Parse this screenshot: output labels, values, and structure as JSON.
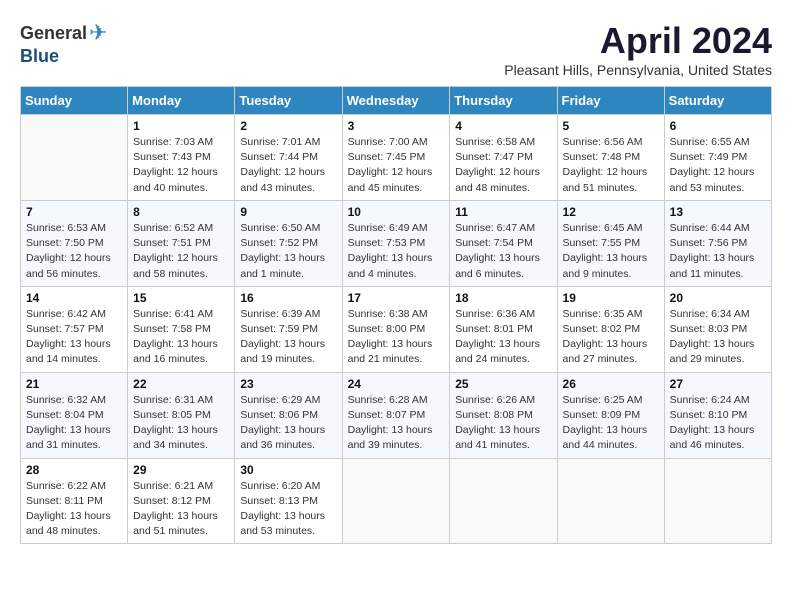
{
  "header": {
    "logo_general": "General",
    "logo_blue": "Blue",
    "title": "April 2024",
    "subtitle": "Pleasant Hills, Pennsylvania, United States"
  },
  "days_of_week": [
    "Sunday",
    "Monday",
    "Tuesday",
    "Wednesday",
    "Thursday",
    "Friday",
    "Saturday"
  ],
  "weeks": [
    [
      {
        "day": "",
        "info": ""
      },
      {
        "day": "1",
        "info": "Sunrise: 7:03 AM\nSunset: 7:43 PM\nDaylight: 12 hours\nand 40 minutes."
      },
      {
        "day": "2",
        "info": "Sunrise: 7:01 AM\nSunset: 7:44 PM\nDaylight: 12 hours\nand 43 minutes."
      },
      {
        "day": "3",
        "info": "Sunrise: 7:00 AM\nSunset: 7:45 PM\nDaylight: 12 hours\nand 45 minutes."
      },
      {
        "day": "4",
        "info": "Sunrise: 6:58 AM\nSunset: 7:47 PM\nDaylight: 12 hours\nand 48 minutes."
      },
      {
        "day": "5",
        "info": "Sunrise: 6:56 AM\nSunset: 7:48 PM\nDaylight: 12 hours\nand 51 minutes."
      },
      {
        "day": "6",
        "info": "Sunrise: 6:55 AM\nSunset: 7:49 PM\nDaylight: 12 hours\nand 53 minutes."
      }
    ],
    [
      {
        "day": "7",
        "info": "Sunrise: 6:53 AM\nSunset: 7:50 PM\nDaylight: 12 hours\nand 56 minutes."
      },
      {
        "day": "8",
        "info": "Sunrise: 6:52 AM\nSunset: 7:51 PM\nDaylight: 12 hours\nand 58 minutes."
      },
      {
        "day": "9",
        "info": "Sunrise: 6:50 AM\nSunset: 7:52 PM\nDaylight: 13 hours\nand 1 minute."
      },
      {
        "day": "10",
        "info": "Sunrise: 6:49 AM\nSunset: 7:53 PM\nDaylight: 13 hours\nand 4 minutes."
      },
      {
        "day": "11",
        "info": "Sunrise: 6:47 AM\nSunset: 7:54 PM\nDaylight: 13 hours\nand 6 minutes."
      },
      {
        "day": "12",
        "info": "Sunrise: 6:45 AM\nSunset: 7:55 PM\nDaylight: 13 hours\nand 9 minutes."
      },
      {
        "day": "13",
        "info": "Sunrise: 6:44 AM\nSunset: 7:56 PM\nDaylight: 13 hours\nand 11 minutes."
      }
    ],
    [
      {
        "day": "14",
        "info": "Sunrise: 6:42 AM\nSunset: 7:57 PM\nDaylight: 13 hours\nand 14 minutes."
      },
      {
        "day": "15",
        "info": "Sunrise: 6:41 AM\nSunset: 7:58 PM\nDaylight: 13 hours\nand 16 minutes."
      },
      {
        "day": "16",
        "info": "Sunrise: 6:39 AM\nSunset: 7:59 PM\nDaylight: 13 hours\nand 19 minutes."
      },
      {
        "day": "17",
        "info": "Sunrise: 6:38 AM\nSunset: 8:00 PM\nDaylight: 13 hours\nand 21 minutes."
      },
      {
        "day": "18",
        "info": "Sunrise: 6:36 AM\nSunset: 8:01 PM\nDaylight: 13 hours\nand 24 minutes."
      },
      {
        "day": "19",
        "info": "Sunrise: 6:35 AM\nSunset: 8:02 PM\nDaylight: 13 hours\nand 27 minutes."
      },
      {
        "day": "20",
        "info": "Sunrise: 6:34 AM\nSunset: 8:03 PM\nDaylight: 13 hours\nand 29 minutes."
      }
    ],
    [
      {
        "day": "21",
        "info": "Sunrise: 6:32 AM\nSunset: 8:04 PM\nDaylight: 13 hours\nand 31 minutes."
      },
      {
        "day": "22",
        "info": "Sunrise: 6:31 AM\nSunset: 8:05 PM\nDaylight: 13 hours\nand 34 minutes."
      },
      {
        "day": "23",
        "info": "Sunrise: 6:29 AM\nSunset: 8:06 PM\nDaylight: 13 hours\nand 36 minutes."
      },
      {
        "day": "24",
        "info": "Sunrise: 6:28 AM\nSunset: 8:07 PM\nDaylight: 13 hours\nand 39 minutes."
      },
      {
        "day": "25",
        "info": "Sunrise: 6:26 AM\nSunset: 8:08 PM\nDaylight: 13 hours\nand 41 minutes."
      },
      {
        "day": "26",
        "info": "Sunrise: 6:25 AM\nSunset: 8:09 PM\nDaylight: 13 hours\nand 44 minutes."
      },
      {
        "day": "27",
        "info": "Sunrise: 6:24 AM\nSunset: 8:10 PM\nDaylight: 13 hours\nand 46 minutes."
      }
    ],
    [
      {
        "day": "28",
        "info": "Sunrise: 6:22 AM\nSunset: 8:11 PM\nDaylight: 13 hours\nand 48 minutes."
      },
      {
        "day": "29",
        "info": "Sunrise: 6:21 AM\nSunset: 8:12 PM\nDaylight: 13 hours\nand 51 minutes."
      },
      {
        "day": "30",
        "info": "Sunrise: 6:20 AM\nSunset: 8:13 PM\nDaylight: 13 hours\nand 53 minutes."
      },
      {
        "day": "",
        "info": ""
      },
      {
        "day": "",
        "info": ""
      },
      {
        "day": "",
        "info": ""
      },
      {
        "day": "",
        "info": ""
      }
    ]
  ]
}
